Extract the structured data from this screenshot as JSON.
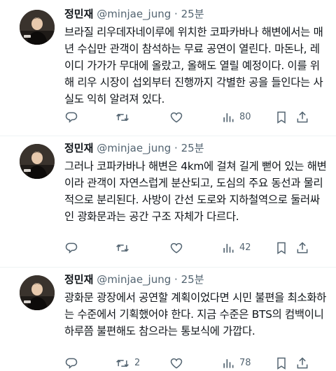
{
  "tweets": [
    {
      "name": "정민재",
      "handle": "@minjae_jung",
      "separator": "·",
      "time": "25분",
      "text": "브라질 리우데자네이루에 위치한 코파카바나 해변에서는 매년 수십만 관객이 참석하는 무료 공연이 열린다. 마돈나, 레이디 가가가 무대에 올랐고, 올해도 열릴 예정이다. 이를 위해 리우 시장이 섭외부터 진행까지 각별한 공을 들인다는 사실도 익히 알려져 있다.",
      "replies": "",
      "retweets": "",
      "likes": "",
      "views": "80",
      "icons": [
        "reply-icon",
        "retweet-icon",
        "heart-icon",
        "views-icon",
        "bookmark-icon",
        "share-icon"
      ]
    },
    {
      "name": "정민재",
      "handle": "@minjae_jung",
      "separator": "·",
      "time": "25분",
      "text": "그러나 코파카바나 해변은 4km에 걸쳐 길게 뻗어 있는 해변이라 관객이 자연스럽게 분산되고, 도심의 주요 동선과 물리적으로 분리된다. 사방이 간선 도로와 지하철역으로 둘러싸인 광화문과는 공간 구조 자체가 다르다.",
      "replies": "",
      "retweets": "",
      "likes": "",
      "views": "42",
      "icons": [
        "reply-icon",
        "retweet-icon",
        "heart-icon",
        "views-icon",
        "bookmark-icon",
        "share-icon"
      ]
    },
    {
      "name": "정민재",
      "handle": "@minjae_jung",
      "separator": "·",
      "time": "25분",
      "text": "광화문 광장에서 공연할 계획이었다면 시민 불편을 최소화하는 수준에서 기획했어야 한다. 지금 수준은 BTS의 컴백이니 하루쯤 불편해도 참으라는 통보식에 가깝다.",
      "replies": "",
      "retweets": "2",
      "likes": "",
      "views": "78",
      "icons": [
        "reply-icon",
        "retweet-icon",
        "heart-icon",
        "views-icon",
        "bookmark-icon",
        "share-icon"
      ]
    }
  ],
  "colors": {
    "text": "#0f1419",
    "secondary": "#536471",
    "divider": "#eff3f4"
  }
}
